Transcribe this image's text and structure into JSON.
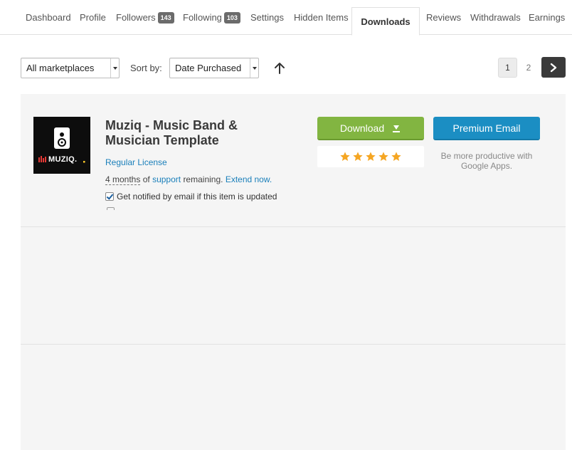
{
  "tabs": [
    {
      "label": "Dashboard"
    },
    {
      "label": "Profile"
    },
    {
      "label": "Followers",
      "badge": "143"
    },
    {
      "label": "Following",
      "badge": "103"
    },
    {
      "label": "Settings"
    },
    {
      "label": "Hidden Items"
    },
    {
      "label": "Downloads",
      "active": true
    },
    {
      "label": "Reviews"
    },
    {
      "label": "Withdrawals"
    },
    {
      "label": "Earnings"
    }
  ],
  "filters": {
    "marketplace_value": "All marketplaces",
    "sort_label": "Sort by:",
    "sort_value": "Date Purchased",
    "sort_direction_icon": "arrow-up-icon"
  },
  "pagination": {
    "pages": [
      "1",
      "2"
    ],
    "current": "1",
    "next_icon": "chevron-right-icon"
  },
  "item": {
    "title": "Muziq - Music Band & Musician Template",
    "thumbnail_text": "MUZIQ.",
    "license": "Regular License",
    "support_duration": "4 months",
    "support_of": "of",
    "support_link": "support",
    "support_remaining": "remaining.",
    "extend_link": "Extend now.",
    "notify_label": "Get notified by email if this item is updated",
    "notify_checked": true,
    "download_label": "Download",
    "rating": 5,
    "premium_label": "Premium Email",
    "premium_note": "Be more productive with Google Apps."
  },
  "colors": {
    "download_green": "#82b541",
    "premium_blue": "#1b8ec3",
    "link_blue": "#1a7fba",
    "star_gold": "#f5a623"
  }
}
